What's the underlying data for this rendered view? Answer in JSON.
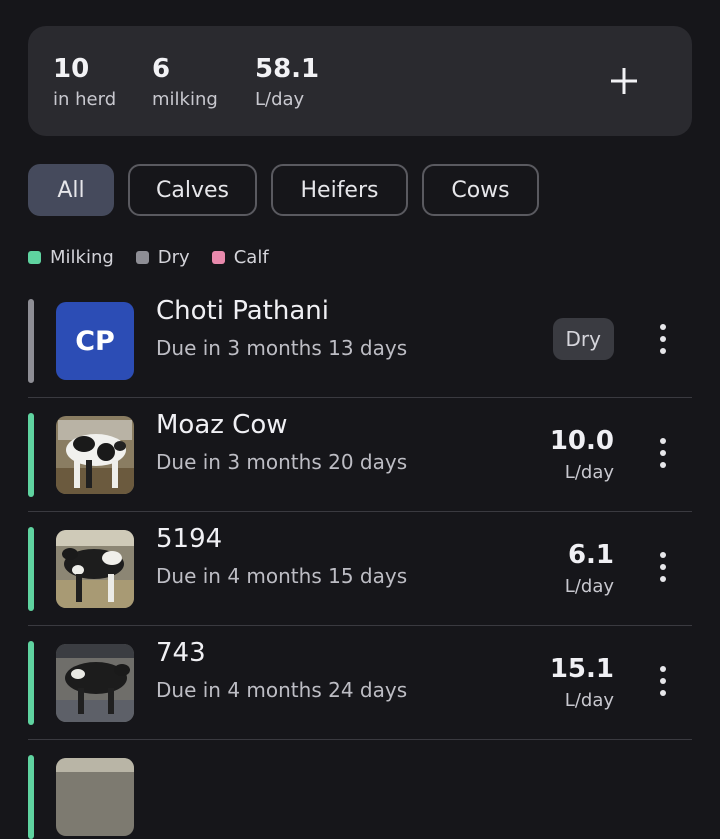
{
  "stats": {
    "herd": {
      "value": "10",
      "label": "in herd"
    },
    "milking": {
      "value": "6",
      "label": "milking"
    },
    "yield": {
      "value": "58.1",
      "label": "L/day"
    }
  },
  "add_icon": "plus-icon",
  "filters": [
    {
      "label": "All",
      "active": true
    },
    {
      "label": "Calves",
      "active": false
    },
    {
      "label": "Heifers",
      "active": false
    },
    {
      "label": "Cows",
      "active": false
    }
  ],
  "legend": [
    {
      "label": "Milking",
      "color": "#5fd3a0"
    },
    {
      "label": "Dry",
      "color": "#8e8e95"
    },
    {
      "label": "Calf",
      "color": "#e889ac"
    }
  ],
  "animals": [
    {
      "name": "Choti Pathani",
      "due": "Due in 3 months 13 days",
      "status": "dry",
      "initials": "CP",
      "badge": "Dry"
    },
    {
      "name": "Moaz Cow",
      "due": "Due in 3 months 20 days",
      "status": "milking",
      "yield": "10.0",
      "unit": "L/day"
    },
    {
      "name": "5194",
      "due": "Due in 4 months 15 days",
      "status": "milking",
      "yield": "6.1",
      "unit": "L/day"
    },
    {
      "name": "743",
      "due": "Due in 4 months 24 days",
      "status": "milking",
      "yield": "15.1",
      "unit": "L/day"
    }
  ],
  "status_colors": {
    "milking": "#5fd3a0",
    "dry": "#8e8e95",
    "calf": "#e889ac"
  }
}
